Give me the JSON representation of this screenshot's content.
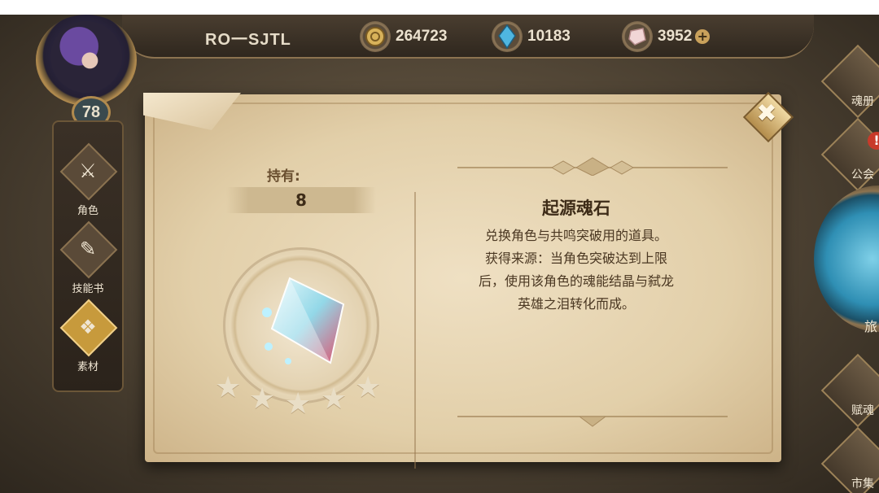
{
  "header": {
    "player_name": "RO一SJTL",
    "level": "78",
    "currencies": [
      {
        "icon": "gold-coin-icon",
        "value": "264723"
      },
      {
        "icon": "blue-crystal-icon",
        "value": "10183"
      },
      {
        "icon": "pink-gem-icon",
        "value": "3952"
      }
    ],
    "add_label": "+"
  },
  "left_nav": [
    {
      "icon": "character-icon",
      "label": "角色"
    },
    {
      "icon": "skill-book-icon",
      "label": "技能书"
    },
    {
      "icon": "material-icon",
      "label": "素材",
      "active": true
    }
  ],
  "right_nav": [
    {
      "icon": "soul-book-icon",
      "label": "魂册"
    },
    {
      "icon": "guild-icon",
      "label": "公会",
      "alert": "!"
    },
    {
      "icon": "travel-icon",
      "label": "旅"
    },
    {
      "icon": "talent-icon",
      "label": "赋魂"
    },
    {
      "icon": "market-icon",
      "label": "市集"
    }
  ],
  "item_dialog": {
    "hold_label": "持有:",
    "hold_value": "8",
    "item_name": "起源魂石",
    "description_lines": [
      "兑换角色与共鸣突破用的道具。",
      "获得来源：当角色突破达到上限",
      "后，使用该角色的魂能结晶与弑龙",
      "英雄之泪转化而成。"
    ],
    "rarity_stars": 5,
    "close_label": "✖"
  },
  "colors": {
    "parchment": "#e6d4b0",
    "text_dark": "#3e2c18",
    "accent_gold": "#c79a3c"
  }
}
